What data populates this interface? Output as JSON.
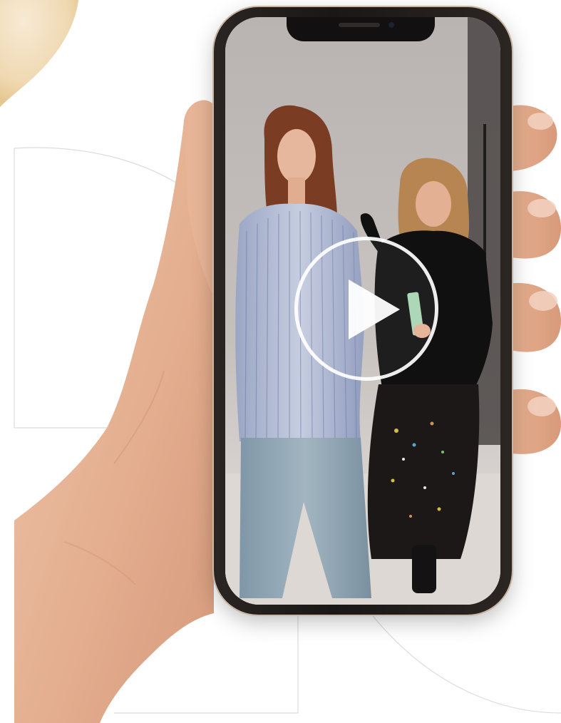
{
  "video": {
    "play_button_label": "",
    "icon": "play-icon"
  },
  "colors": {
    "background": "#ffffff",
    "accent_blob": "#f2dfbf",
    "decorative_line": "#d9d9d9",
    "phone_frame": "#1a1716",
    "skin": "#e8b99c"
  }
}
